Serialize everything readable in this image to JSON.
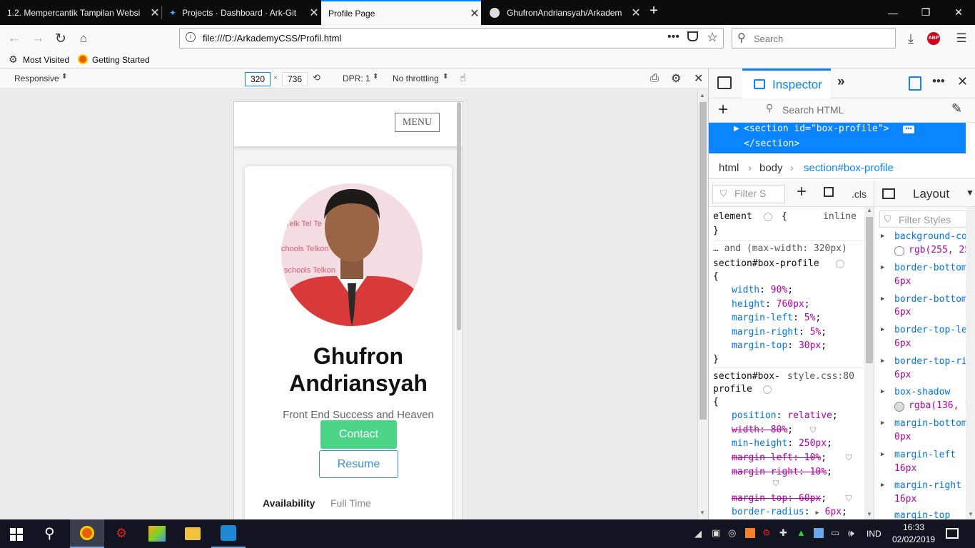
{
  "tabs": [
    {
      "label": "1.2. Mempercantik Tampilan Websi"
    },
    {
      "label": "Projects · Dashboard · Ark-Git"
    },
    {
      "label": "Profile Page"
    },
    {
      "label": "GhufronAndriansyah/Arkadem"
    }
  ],
  "nav": {
    "url": "file:///D:/ArkademyCSS/Profil.html",
    "search_placeholder": "Search"
  },
  "bookmarks": [
    {
      "label": "Most Visited"
    },
    {
      "label": "Getting Started"
    }
  ],
  "rdm": {
    "device": "Responsive",
    "width": "320",
    "height": "736",
    "dpr": "DPR: 1",
    "throttling": "No throttling"
  },
  "page": {
    "menu": "MENU",
    "name_line1": "Ghufron",
    "name_line2": "Andriansyah",
    "subtitle": "Front End Success and Heaven",
    "contact": "Contact",
    "resume": "Resume",
    "availability_label": "Availability",
    "availability_value": "Full Time"
  },
  "devtools": {
    "inspector_tab": "Inspector",
    "search_html": "Search HTML",
    "markup_open": "<section id=\"box-profile\">",
    "markup_close": "</section>",
    "breadcrumbs": [
      "html",
      "body",
      "section#box-profile"
    ],
    "filter_styles": "Filter S",
    "cls": ".cls",
    "layout_tab": "Layout",
    "computed_filter": "Filter Styles",
    "rules": {
      "element_selector": "element",
      "element_source": "inline",
      "media": "… and (max-width: 320px)",
      "rule1_selector": "section#box-profile",
      "rule1_props": [
        {
          "name": "width",
          "value": "90%"
        },
        {
          "name": "height",
          "value": "760px"
        },
        {
          "name": "margin-left",
          "value": "5%"
        },
        {
          "name": "margin-right",
          "value": "5%"
        },
        {
          "name": "margin-top",
          "value": "30px"
        }
      ],
      "rule2_selector_a": "section#box-",
      "rule2_selector_b": "profile",
      "rule2_source": "style.css:80",
      "rule2_props": [
        {
          "name": "position",
          "value": "relative"
        },
        {
          "name": "width",
          "value": "80%"
        },
        {
          "name": "min-height",
          "value": "250px"
        },
        {
          "name": "margin-left",
          "value": "10%"
        },
        {
          "name": "margin-right",
          "value": "10%"
        },
        {
          "name": "margin-top",
          "value": "60px"
        },
        {
          "name": "border-radius",
          "value": "6px"
        }
      ]
    },
    "computed": [
      {
        "name": "background-col",
        "value": "rgb(255, 25"
      },
      {
        "name": "border-bottom-",
        "value": "6px"
      },
      {
        "name": "border-bottom-",
        "value": "6px"
      },
      {
        "name": "border-top-lef",
        "value": "6px"
      },
      {
        "name": "border-top-rig",
        "value": "6px"
      },
      {
        "name": "box-shadow",
        "value": "rgba(136, 1"
      },
      {
        "name": "margin-bottom",
        "value": "0px"
      },
      {
        "name": "margin-left",
        "value": "16px"
      },
      {
        "name": "margin-right",
        "value": "16px"
      },
      {
        "name": "margin-top",
        "value": ""
      }
    ]
  },
  "taskbar": {
    "lang": "IND",
    "time": "16:33",
    "date": "02/02/2019"
  },
  "colors": {
    "accent": "#0a84ff",
    "selection": "#0a84ff",
    "contact_green": "#4cd488",
    "resume_blue": "#3b8fd8"
  }
}
